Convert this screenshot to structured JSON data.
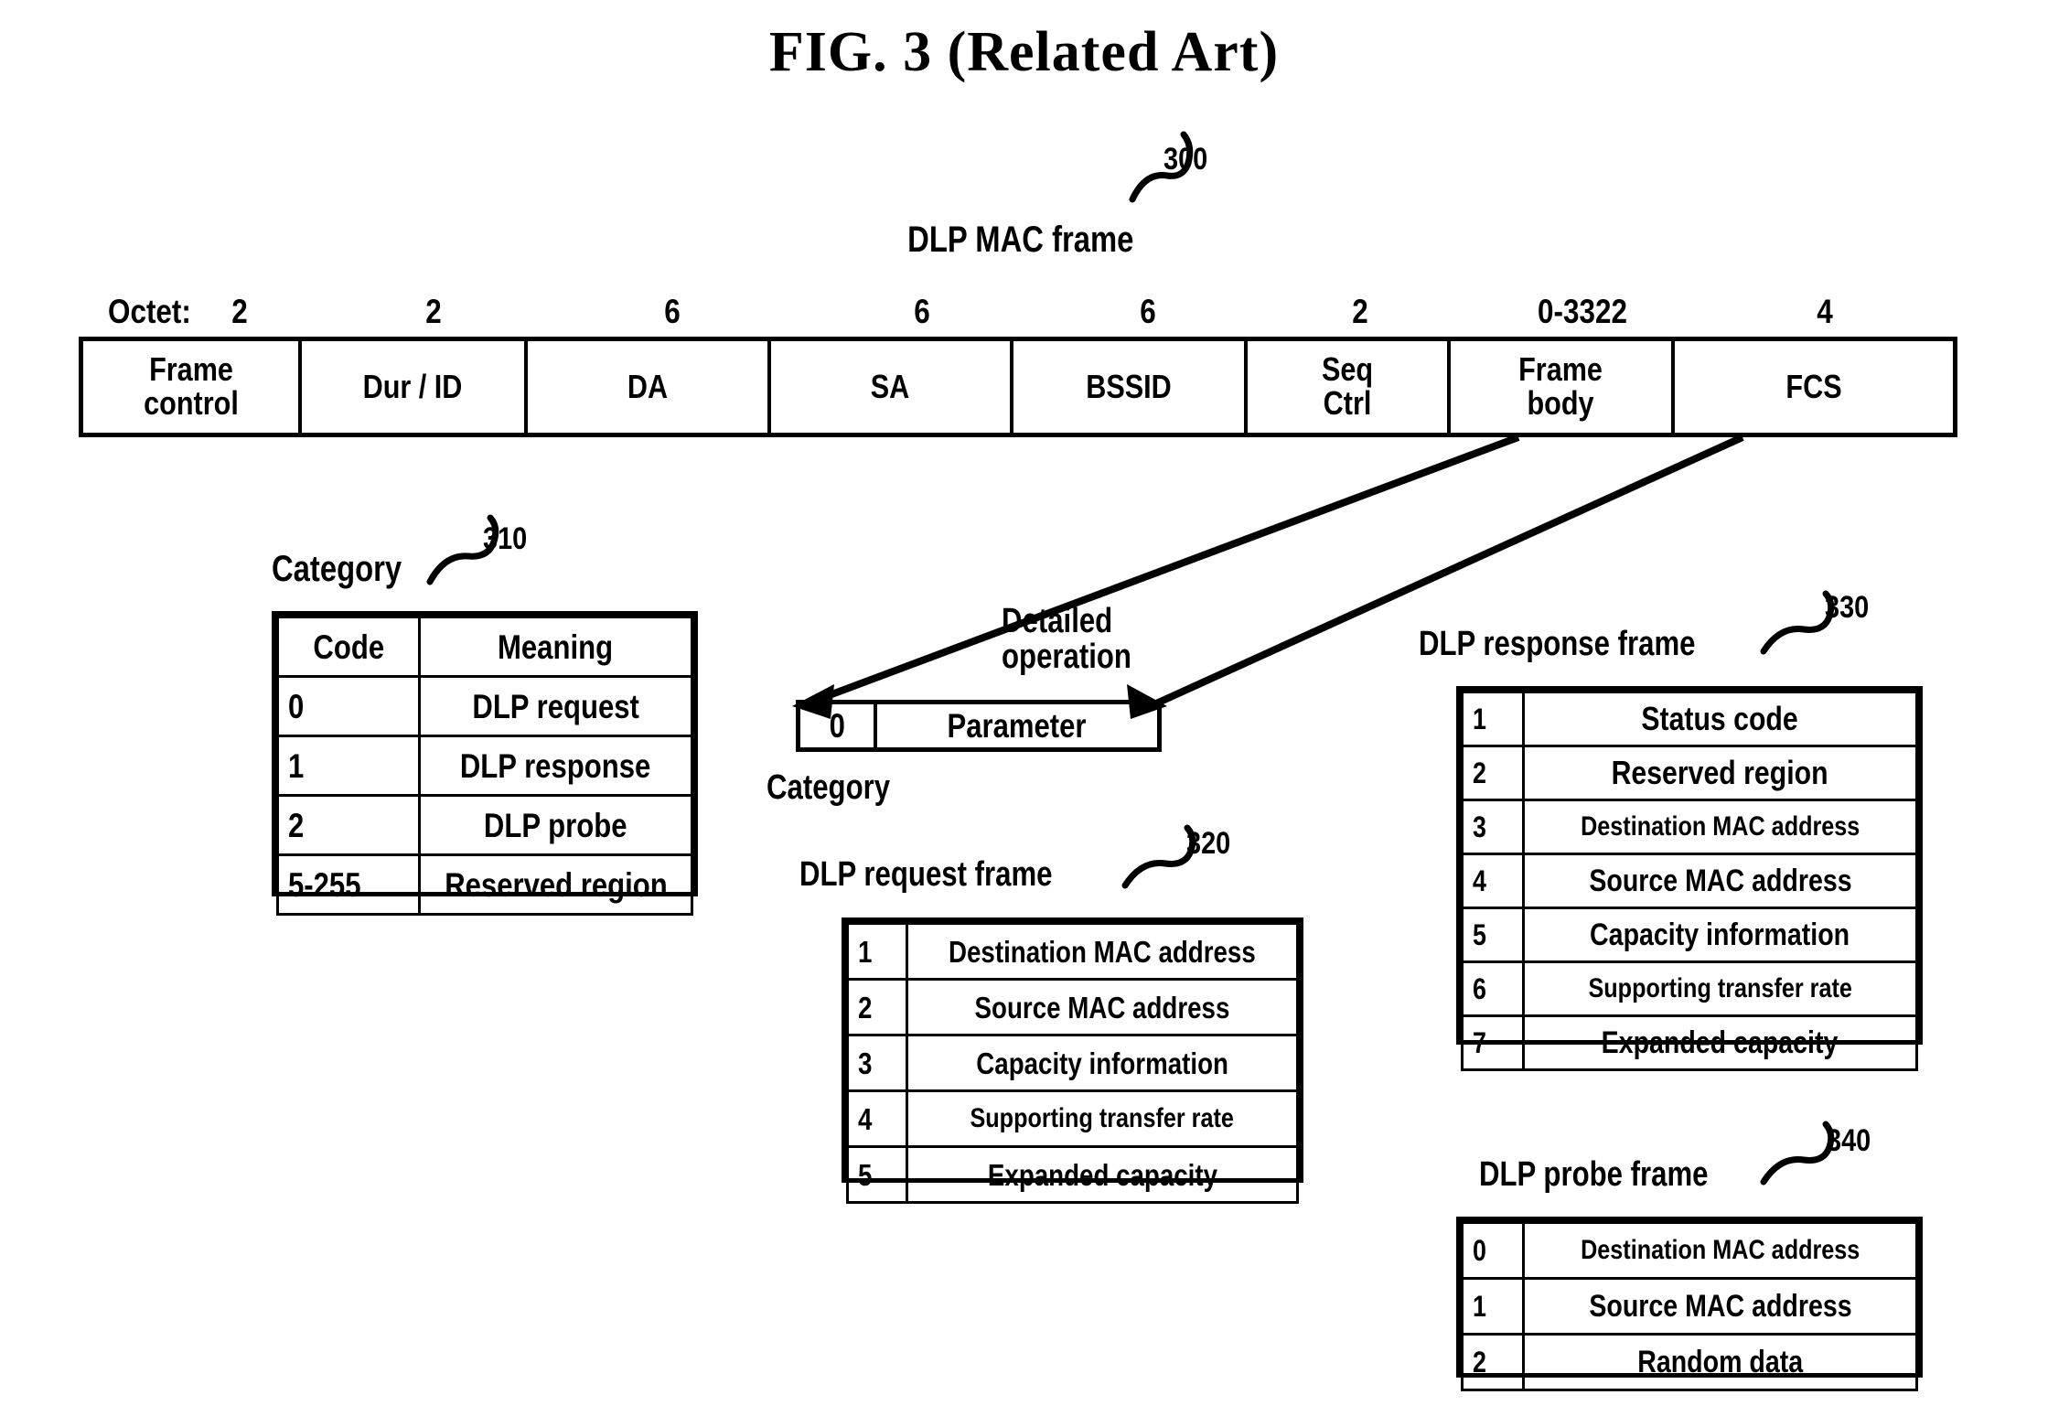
{
  "figure": {
    "title": "FIG. 3 (Related Art)"
  },
  "mac_frame": {
    "caption": "DLP MAC frame",
    "ref": "300",
    "octet_prefix": "Octet:",
    "octets": [
      "2",
      "2",
      "6",
      "6",
      "6",
      "2",
      "0-3322",
      "4"
    ],
    "fields": [
      "Frame\ncontrol",
      "Dur / ID",
      "DA",
      "SA",
      "BSSID",
      "Seq\nCtrl",
      "Frame\nbody",
      "FCS"
    ]
  },
  "category_table": {
    "caption": "Category",
    "ref": "310",
    "headers": [
      "Code",
      "Meaning"
    ],
    "rows": [
      [
        "0",
        "DLP request"
      ],
      [
        "1",
        "DLP response"
      ],
      [
        "2",
        "DLP probe"
      ],
      [
        "5-255",
        "Reserved region"
      ]
    ]
  },
  "detailed_operation": {
    "top_label": "Detailed\noperation",
    "bottom_label": "Category",
    "cells": [
      "0",
      "Parameter"
    ]
  },
  "request_frame": {
    "caption": "DLP request frame",
    "ref": "320",
    "rows": [
      [
        "1",
        "Destination MAC address"
      ],
      [
        "2",
        "Source MAC address"
      ],
      [
        "3",
        "Capacity information"
      ],
      [
        "4",
        "Supporting transfer rate"
      ],
      [
        "5",
        "Expanded capacity"
      ]
    ]
  },
  "response_frame": {
    "caption": "DLP response frame",
    "ref": "330",
    "rows": [
      [
        "1",
        "Status code"
      ],
      [
        "2",
        "Reserved region"
      ],
      [
        "3",
        "Destination MAC address"
      ],
      [
        "4",
        "Source MAC address"
      ],
      [
        "5",
        "Capacity information"
      ],
      [
        "6",
        "Supporting transfer rate"
      ],
      [
        "7",
        "Expanded capacity"
      ]
    ]
  },
  "probe_frame": {
    "caption": "DLP probe frame",
    "ref": "340",
    "rows": [
      [
        "0",
        "Destination MAC address"
      ],
      [
        "1",
        "Source MAC address"
      ],
      [
        "2",
        "Random data"
      ]
    ]
  }
}
